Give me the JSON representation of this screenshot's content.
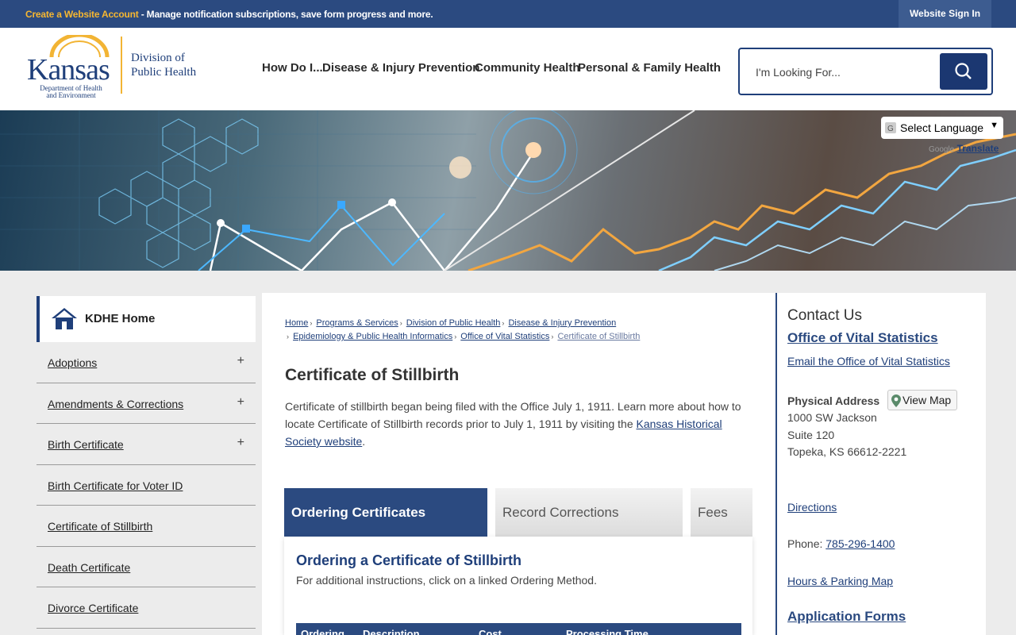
{
  "topbar": {
    "account_link": "Create a Website Account",
    "message": " - Manage notification subscriptions, save form progress and more.",
    "signin": "Website Sign In"
  },
  "logo": {
    "kansas": "Kansas",
    "kdhe_line1": "Department of Health",
    "kdhe_line2": "and Environment",
    "division_line1": "Division of",
    "division_line2": "Public Health"
  },
  "nav": {
    "items": [
      "How Do I...",
      "Disease & Injury Prevention",
      "Community Health",
      "Personal & Family Health"
    ]
  },
  "search": {
    "placeholder": "I'm Looking For..."
  },
  "translate": {
    "select_label": "Select Language",
    "powered": "Google",
    "translate": "Translate"
  },
  "leftnav": {
    "home": "KDHE Home",
    "items": [
      {
        "label": "Adoptions",
        "expand": "+"
      },
      {
        "label": "Amendments & Corrections",
        "expand": "+"
      },
      {
        "label": "Birth Certificate",
        "expand": "+"
      },
      {
        "label": "Birth Certificate for Voter ID",
        "expand": ""
      },
      {
        "label": "Certificate of Stillbirth",
        "expand": ""
      },
      {
        "label": "Death Certificate",
        "expand": ""
      },
      {
        "label": "Divorce Certificate",
        "expand": ""
      }
    ]
  },
  "breadcrumb": [
    "Home",
    "Programs & Services",
    "Division of Public Health",
    "Disease & Injury Prevention",
    "Epidemiology & Public Health Informatics",
    "Office of Vital Statistics",
    "Certificate of Stillbirth"
  ],
  "page": {
    "title": "Certificate of Stillbirth",
    "intro_text": "Certificate of stillbirth began being filed with the Office July 1, 1911. Learn more about how to locate Certificate of Stillbirth records prior to July 1, 1911 by visiting the ",
    "intro_link": "Kansas Historical Society website",
    "intro_end": "."
  },
  "tabs": [
    "Ordering Certificates",
    "Record Corrections",
    "Fees"
  ],
  "tab_panel": {
    "heading": "Ordering a Certificate of Stillbirth",
    "subtext": "For additional instructions, click on a linked Ordering Method.",
    "columns": [
      "Ordering",
      "Description",
      "Cost",
      "Processing Time"
    ]
  },
  "contact": {
    "heading": "Contact Us",
    "office": "Office of Vital Statistics",
    "email": "Email the Office of Vital Statistics",
    "address_label": "Physical Address",
    "view_map": "View Map",
    "address_line1": "1000 SW Jackson",
    "address_line2": "Suite 120",
    "address_line3": "Topeka, KS 66612-2221",
    "directions": "Directions",
    "phone_label": "Phone: ",
    "phone": "785-296-1400",
    "hours": "Hours & Parking Map",
    "forms": "Application Forms"
  },
  "colors": {
    "brand_navy": "#2b4a80",
    "accent_gold": "#f6b731"
  }
}
